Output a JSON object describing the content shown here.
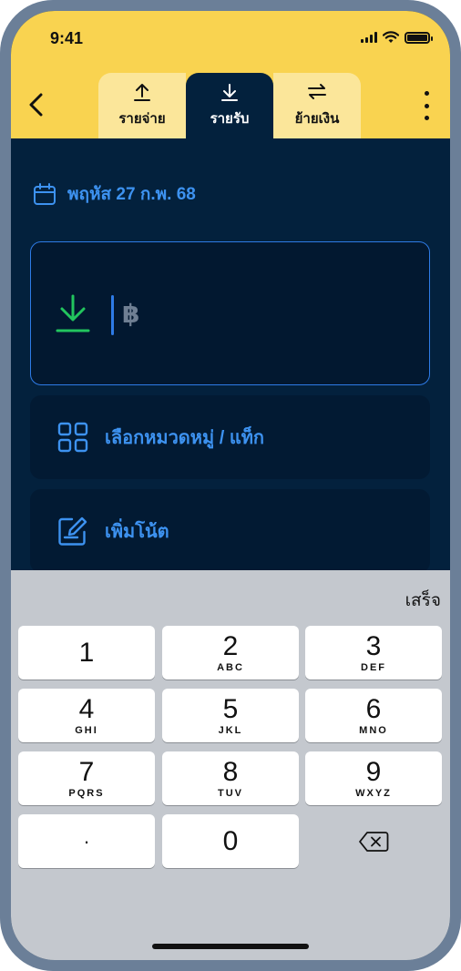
{
  "status_bar": {
    "time": "9:41"
  },
  "tabs": [
    {
      "label": "รายจ่าย",
      "icon": "upload-icon",
      "active": false
    },
    {
      "label": "รายรับ",
      "icon": "download-icon",
      "active": true
    },
    {
      "label": "ย้ายเงิน",
      "icon": "transfer-icon",
      "active": false
    }
  ],
  "date": {
    "label": "พฤหัส 27 ก.พ. 68"
  },
  "amount": {
    "currency_symbol": "฿",
    "value": ""
  },
  "category": {
    "label": "เลือกหมวดหมู่ / แท็ก"
  },
  "note": {
    "label": "เพิ่มโน้ต"
  },
  "keyboard": {
    "done_label": "เสร็จ",
    "keys": [
      {
        "num": "1",
        "letters": ""
      },
      {
        "num": "2",
        "letters": "ABC"
      },
      {
        "num": "3",
        "letters": "DEF"
      },
      {
        "num": "4",
        "letters": "GHI"
      },
      {
        "num": "5",
        "letters": "JKL"
      },
      {
        "num": "6",
        "letters": "MNO"
      },
      {
        "num": "7",
        "letters": "PQRS"
      },
      {
        "num": "8",
        "letters": "TUV"
      },
      {
        "num": "9",
        "letters": "WXYZ"
      },
      {
        "num": "·",
        "letters": ""
      },
      {
        "num": "0",
        "letters": ""
      }
    ]
  },
  "colors": {
    "header": "#f9d350",
    "background": "#03213d",
    "accent_blue": "#3d92f0",
    "income_green": "#22c55e"
  }
}
